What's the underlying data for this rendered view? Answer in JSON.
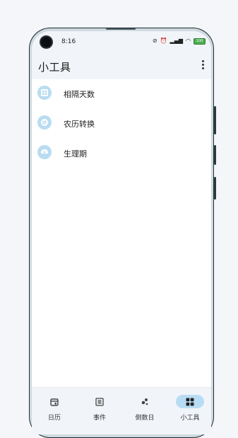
{
  "status_bar": {
    "time": "8:16",
    "battery": "100"
  },
  "app_bar": {
    "title": "小工具"
  },
  "tools": [
    {
      "label": "相隔天数",
      "icon": "calendar-grid-icon"
    },
    {
      "label": "农历转换",
      "icon": "convert-icon"
    },
    {
      "label": "生理期",
      "icon": "cycle-icon"
    }
  ],
  "bottom_nav": [
    {
      "label": "日历",
      "icon": "calendar-icon",
      "active": false
    },
    {
      "label": "事件",
      "icon": "list-icon",
      "active": false
    },
    {
      "label": "倒数日",
      "icon": "countdown-icon",
      "active": false
    },
    {
      "label": "小工具",
      "icon": "apps-icon",
      "active": true
    }
  ],
  "colors": {
    "accent": "#b8dcf3",
    "icon_bg": "#b9dcf1",
    "background": "#f1f5f9"
  }
}
